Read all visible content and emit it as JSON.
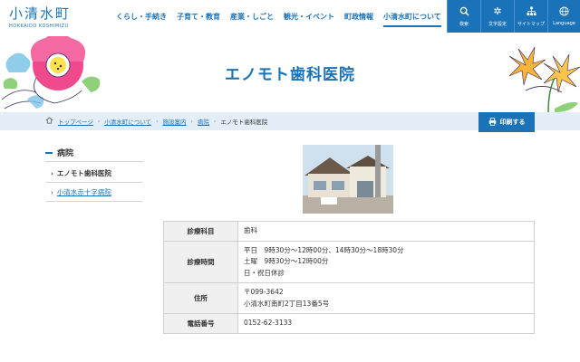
{
  "header": {
    "logo_text": "小清水町",
    "logo_sub": "HOKKAIDO KOSHIMIZU",
    "nav": [
      {
        "label": "くらし・手続き"
      },
      {
        "label": "子育て・教育"
      },
      {
        "label": "産業・しごと"
      },
      {
        "label": "観光・イベント"
      },
      {
        "label": "町政情報"
      },
      {
        "label": "小清水町について"
      }
    ],
    "utility": [
      {
        "label": "検索",
        "icon": "search-icon"
      },
      {
        "label": "文字設定",
        "icon": "gear-icon"
      },
      {
        "label": "サイトマップ",
        "icon": "sitemap-icon"
      },
      {
        "label": "Language",
        "icon": "globe-icon"
      }
    ],
    "accent_color": "#1a73b8"
  },
  "page": {
    "title": "エノモト歯科医院"
  },
  "breadcrumb": {
    "items": [
      "トップページ",
      "小清水町について",
      "施設案内",
      "病院"
    ],
    "current": "エノモト歯科医院"
  },
  "print_button": {
    "label": "印刷する"
  },
  "sidebar": {
    "heading": "病院",
    "items": [
      {
        "label": "エノモト歯科医院"
      },
      {
        "label": "小清水赤十字病院"
      }
    ]
  },
  "info": {
    "rows": [
      {
        "key": "診療科目",
        "lines": [
          "歯科"
        ]
      },
      {
        "key": "診療時間",
        "lines": [
          "平日　9時30分～12時00分、14時30分～18時30分",
          "土曜　9時30分～12時00分",
          "日・祝日休診"
        ]
      },
      {
        "key": "住所",
        "lines": [
          "〒099-3642",
          "小清水町南町2丁目13番5号"
        ]
      },
      {
        "key": "電話番号",
        "lines": [
          "0152-62-3133"
        ]
      }
    ]
  }
}
